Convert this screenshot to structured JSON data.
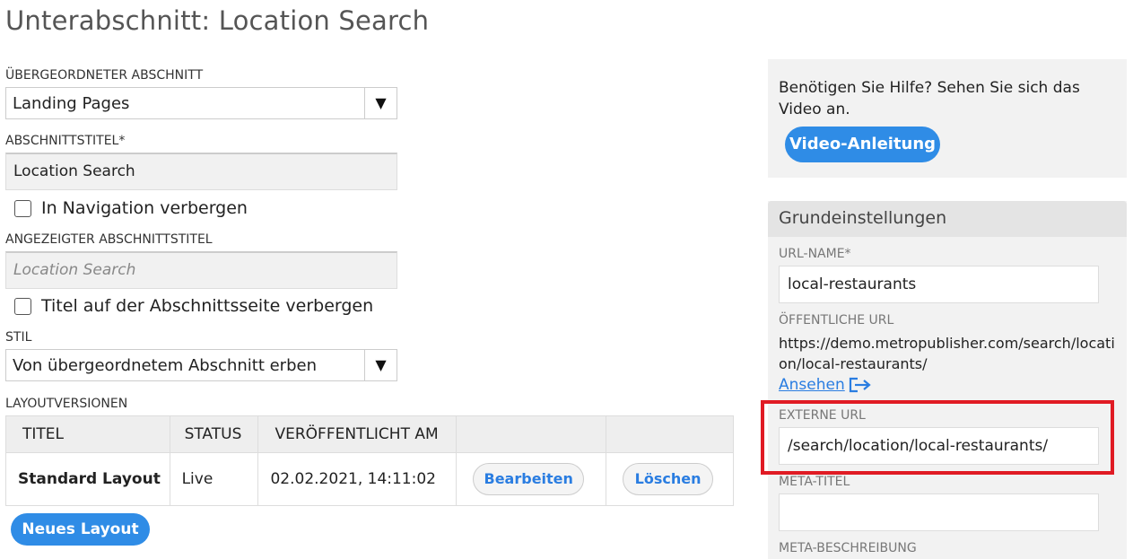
{
  "page": {
    "title": "Unterabschnitt: Location Search"
  },
  "form": {
    "parent_section": {
      "label": "ÜBERGEORDNETER ABSCHNITT",
      "value": "Landing Pages",
      "arrow": "▼"
    },
    "section_title": {
      "label": "ABSCHNITTSTITEL*",
      "value": "Location Search"
    },
    "hide_in_nav": {
      "label": "In Navigation verbergen",
      "checked": false
    },
    "display_title": {
      "label": "ANGEZEIGTER ABSCHNITTSTITEL",
      "placeholder": "Location Search"
    },
    "hide_title": {
      "label": "Titel auf der Abschnittsseite verbergen",
      "checked": false
    },
    "style": {
      "label": "STIL",
      "value": "Von übergeordnetem Abschnitt erben",
      "arrow": "▼"
    }
  },
  "layouts": {
    "label": "LAYOUTVERSIONEN",
    "columns": [
      "TITEL",
      "STATUS",
      "VERÖFFENTLICHT AM",
      "",
      ""
    ],
    "rows": [
      {
        "title": "Standard Layout",
        "status": "Live",
        "published": "02.02.2021, 14:11:02",
        "edit_label": "Bearbeiten",
        "delete_label": "Löschen"
      }
    ],
    "new_button": "Neues Layout"
  },
  "help": {
    "text": "Benötigen Sie Hilfe? Sehen Sie sich das Video an.",
    "button": "Video-Anleitung"
  },
  "settings": {
    "heading": "Grundeinstellungen",
    "url_name_label": "URL-NAME*",
    "url_name_value": "local-restaurants",
    "public_url_label": "ÖFFENTLICHE URL",
    "public_url_value": "https://demo.metropublisher.com/search/location/local-restaurants/",
    "view_link": "Ansehen",
    "external_url_label": "EXTERNE URL",
    "external_url_value": "/search/location/local-restaurants/",
    "meta_title_label": "META-TITEL",
    "meta_title_value": "",
    "meta_description_label": "META-BESCHREIBUNG"
  },
  "colors": {
    "accent": "#2f8ce6",
    "link": "#2a7de1",
    "highlight": "#e01b24"
  },
  "icons": {
    "view_link_icon": "external-link-icon"
  }
}
